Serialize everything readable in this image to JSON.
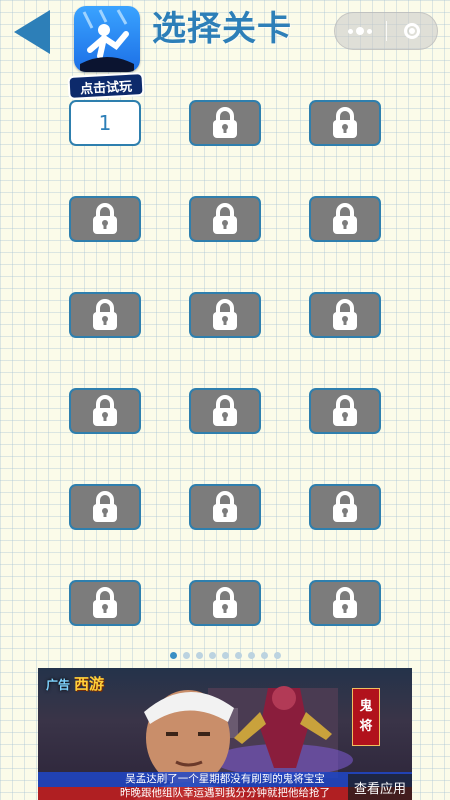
{
  "header": {
    "title": "选择关卡",
    "promo_label": "点击试玩"
  },
  "colors": {
    "accent": "#2d7fb8",
    "locked_fill": "#7c7c7c",
    "background": "#fbfbe9"
  },
  "levels": [
    {
      "label": "1",
      "state": "unlocked"
    },
    {
      "label": "",
      "state": "locked"
    },
    {
      "label": "",
      "state": "locked"
    },
    {
      "label": "",
      "state": "locked"
    },
    {
      "label": "",
      "state": "locked"
    },
    {
      "label": "",
      "state": "locked"
    },
    {
      "label": "",
      "state": "locked"
    },
    {
      "label": "",
      "state": "locked"
    },
    {
      "label": "",
      "state": "locked"
    },
    {
      "label": "",
      "state": "locked"
    },
    {
      "label": "",
      "state": "locked"
    },
    {
      "label": "",
      "state": "locked"
    },
    {
      "label": "",
      "state": "locked"
    },
    {
      "label": "",
      "state": "locked"
    },
    {
      "label": "",
      "state": "locked"
    },
    {
      "label": "",
      "state": "locked"
    },
    {
      "label": "",
      "state": "locked"
    },
    {
      "label": "",
      "state": "locked"
    }
  ],
  "pager": {
    "count": 9,
    "active": 1
  },
  "ad": {
    "tag": "广告",
    "game_title": "西游",
    "side_badge": [
      "鬼",
      "将"
    ],
    "caption_1": "吴孟达刷了一个星期都没有刷到的鬼将宝宝",
    "caption_2": "昨晚跟他组队幸运遇到我分分钟就把他给抢了",
    "cta": "查看应用"
  }
}
